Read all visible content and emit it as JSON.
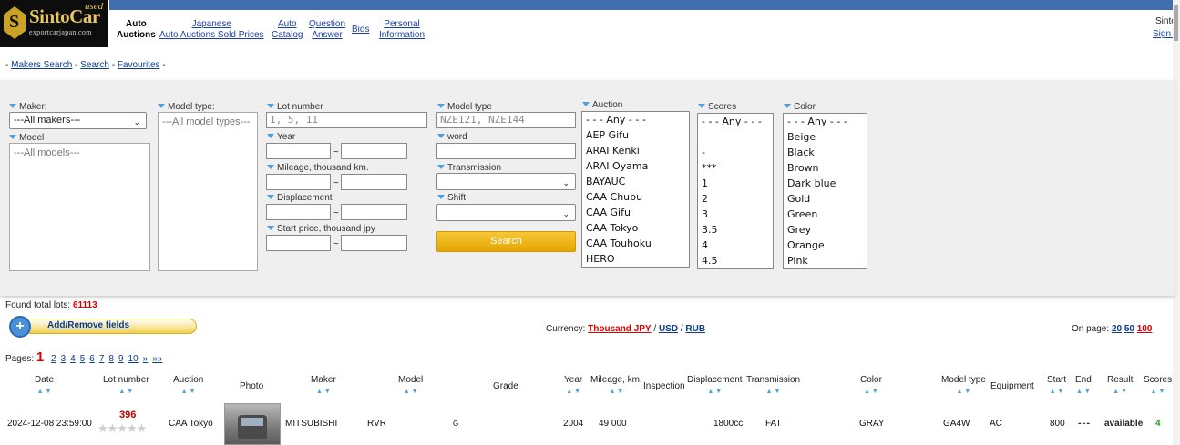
{
  "logo": {
    "brand": "SintoCar",
    "used": "used",
    "site": "exportcarjapan.com"
  },
  "nav": [
    {
      "line1": "Auto",
      "line2": "Auctions",
      "active": true
    },
    {
      "line1": "Japanese",
      "line2": "Auto Auctions Sold Prices"
    },
    {
      "line1": "Auto",
      "line2": "Catalog"
    },
    {
      "line1": "Question",
      "line2": "Answer"
    },
    {
      "line1": "Bids",
      "line2": ""
    },
    {
      "line1": "Personal",
      "line2": "Information"
    }
  ],
  "user": {
    "name": "Sinto",
    "signout": "Sign o"
  },
  "breadcrumb": {
    "makers": "Makers Search",
    "search": "Search",
    "favourites": "Favourites"
  },
  "filters": {
    "maker_label": "Maker:",
    "maker_value": "---All makers---",
    "model_label": "Model",
    "model_value": "---All models---",
    "model_type_label": "Model type:",
    "model_type_value": "---All model types---",
    "lot_label": "Lot number",
    "lot_placeholder": "1, 5, 11",
    "year_label": "Year",
    "mileage_label": "Mileage, thousand km.",
    "displacement_label": "Displacement",
    "start_price_label": "Start price, thousand jpy",
    "model_type2_label": "Model type",
    "model_type2_placeholder": "NZE121, NZE144",
    "word_label": "word",
    "transmission_label": "Transmission",
    "shift_label": "Shift",
    "search_button": "Search",
    "auction_label": "Auction",
    "auctions": [
      "- - - Any - - -",
      "AEP Gifu",
      "ARAI Kenki",
      "ARAI Oyama",
      "BAYAUC",
      "CAA Chubu",
      "CAA Gifu",
      "CAA Tokyo",
      "CAA Touhoku",
      "HERO"
    ],
    "scores_label": "Scores",
    "scores": [
      "- - - Any - - -",
      "",
      "-",
      "***",
      "1",
      "2",
      "3",
      "3.5",
      "4",
      "4.5"
    ],
    "color_label": "Color",
    "colors": [
      "- - - Any - - -",
      "Beige",
      "Black",
      "Brown",
      "Dark blue",
      "Gold",
      "Green",
      "Grey",
      "Orange",
      "Pink"
    ],
    "tilde": "~"
  },
  "results": {
    "found_label": "Found total lots:",
    "found_count": "61113",
    "add_remove": "Add/Remove fields",
    "currency_label": "Currency:",
    "currency_jpy": "Thousand JPY",
    "currency_usd": "USD",
    "currency_rub": "RUB",
    "onpage_label": "On page:",
    "onpage": [
      "20",
      "50",
      "100"
    ],
    "pages_label": "Pages:",
    "pages_current": "1",
    "pages": [
      "2",
      "3",
      "4",
      "5",
      "6",
      "7",
      "8",
      "9",
      "10",
      "»",
      "»»"
    ]
  },
  "table": {
    "headers": {
      "date": "Date",
      "lot": "Lot number",
      "auction": "Auction",
      "photo": "Photo",
      "maker": "Maker",
      "model": "Model",
      "grade": "Grade",
      "year": "Year",
      "mileage": "Mileage, km.",
      "inspection": "Inspection",
      "displacement": "Displacement",
      "transmission": "Transmission",
      "color": "Color",
      "model_type": "Model type",
      "equipment": "Equipment",
      "start": "Start",
      "end": "End",
      "result": "Result",
      "scores": "Scores"
    },
    "row": {
      "date": "2024-12-08 23:59:00",
      "lot": "396",
      "stars": "★★★★★",
      "auction": "CAA Tokyo",
      "maker": "MITSUBISHI",
      "model": "RVR",
      "grade": "G",
      "year": "2004",
      "mileage": "49 000",
      "displacement": "1800cc",
      "transmission": "FAT",
      "color": "GRAY",
      "model_type": "GA4W",
      "equipment": "AC",
      "start": "800",
      "end": "---",
      "result": "available",
      "scores": "4"
    }
  },
  "sort_glyph": "▲ ▼",
  "colors": {
    "accent_blue": "#3f6fae",
    "search_button": "#f0b400",
    "highlight_red": "#dd0000"
  }
}
